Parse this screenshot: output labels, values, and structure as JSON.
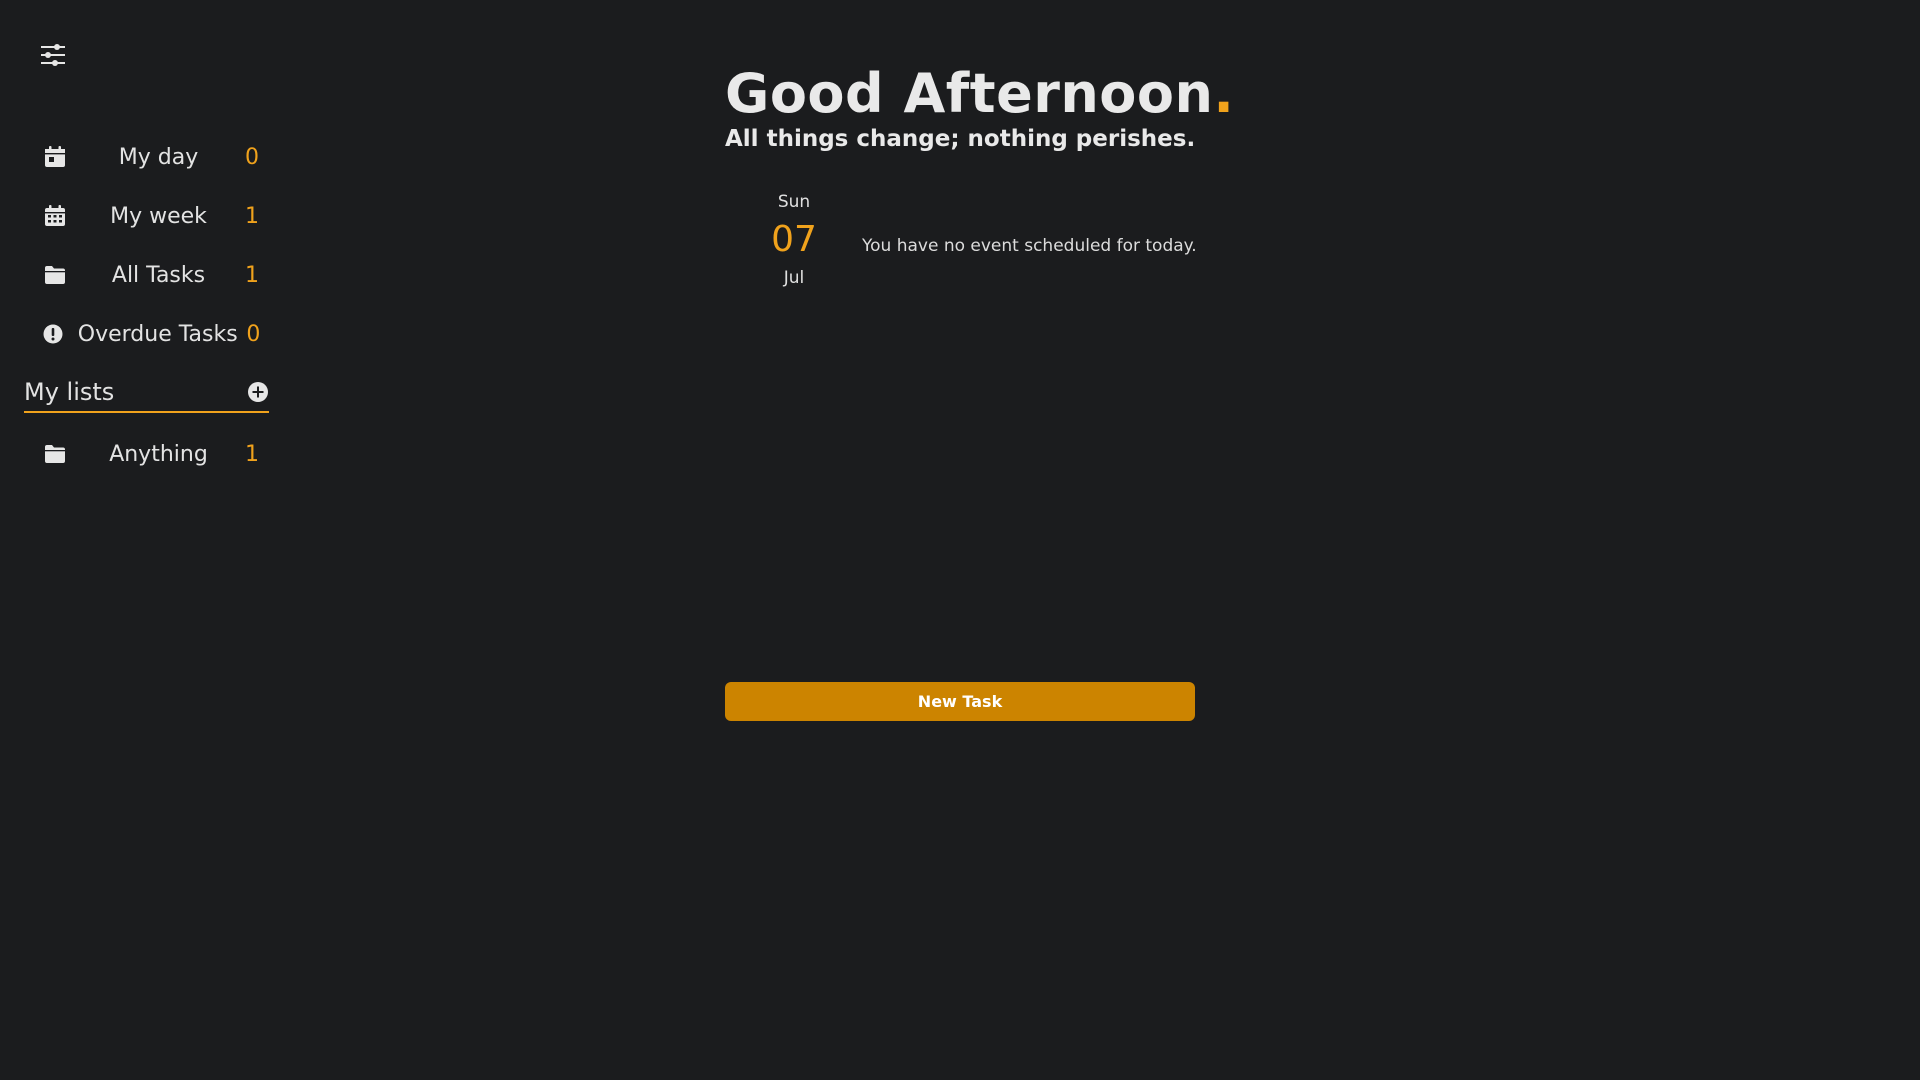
{
  "sidebar": {
    "settings_icon": "sliders-icon",
    "items": [
      {
        "label": "My day",
        "count": "0",
        "icon": "calendar-day-icon"
      },
      {
        "label": "My week",
        "count": "1",
        "icon": "calendar-week-icon"
      },
      {
        "label": "All Tasks",
        "count": "1",
        "icon": "folder-icon"
      },
      {
        "label": "Overdue Tasks",
        "count": "0",
        "icon": "alert-circle-icon"
      }
    ],
    "lists_title": "My lists",
    "add_list_icon": "plus-circle-icon",
    "lists": [
      {
        "label": "Anything",
        "count": "1",
        "icon": "folder-icon"
      }
    ]
  },
  "main": {
    "greeting": "Good Afternoon",
    "greeting_dot": ".",
    "quote": "All things change; nothing perishes.",
    "date": {
      "day_of_week": "Sun",
      "day": "07",
      "month": "Jul"
    },
    "no_events_text": "You have no event scheduled for today.",
    "new_task_label": "New Task"
  },
  "colors": {
    "background": "#1b1c1e",
    "accent": "#f0a21c",
    "button": "#cc8400",
    "text": "#e6e6e6"
  }
}
